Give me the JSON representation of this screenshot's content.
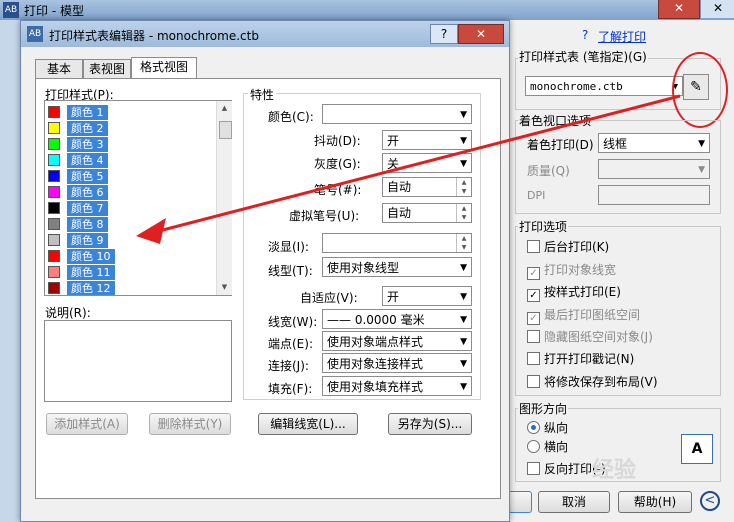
{
  "colors": {
    "accent": "#3b84d8",
    "annotation_red": "#e02020",
    "title_gradient": "#9ebadb"
  },
  "bg_window": {
    "title": "打印 - 模型",
    "app_icon": "AB",
    "close": "✕",
    "close2": "✕"
  },
  "plot_style_group": {
    "label": "打印样式表 (笔指定)(G)",
    "value": "monochrome.ctb",
    "help_link": "了解打印",
    "help_icon": "?"
  },
  "viewport_group": {
    "label": "着色视口选项",
    "shade_label": "着色打印(D)",
    "shade_value": "线框",
    "quality_label": "质量(Q)",
    "quality_value": "",
    "dpi_label": "DPI",
    "dpi_value": ""
  },
  "options_group": {
    "label": "打印选项",
    "items": [
      {
        "label": "后台打印(K)",
        "checked": false,
        "enabled": true
      },
      {
        "label": "打印对象线宽",
        "checked": true,
        "enabled": false
      },
      {
        "label": "按样式打印(E)",
        "checked": true,
        "enabled": true
      },
      {
        "label": "最后打印图纸空间",
        "checked": true,
        "enabled": false
      },
      {
        "label": "隐藏图纸空间对象(J)",
        "checked": false,
        "enabled": false
      },
      {
        "label": "打开打印戳记(N)",
        "checked": false,
        "enabled": true
      },
      {
        "label": "将修改保存到布局(V)",
        "checked": false,
        "enabled": true
      }
    ]
  },
  "orientation_group": {
    "label": "图形方向",
    "portrait": "纵向",
    "landscape": "横向",
    "reverse": "反向打印(-)",
    "icon": "A",
    "selected": "portrait"
  },
  "bottom_buttons": {
    "cancel": "取消",
    "help": "帮助(H)",
    "back_icon": "<"
  },
  "watermark": "经验",
  "editor": {
    "title": "打印样式表编辑器 - monochrome.ctb",
    "help_btn": "?",
    "close_btn": "✕",
    "tabs": [
      "基本",
      "表视图",
      "格式视图"
    ],
    "active_tab": 2,
    "styles_label": "打印样式(P):",
    "styles": [
      {
        "name": "颜色 1",
        "color": "#ff0000"
      },
      {
        "name": "颜色 2",
        "color": "#ffff00"
      },
      {
        "name": "颜色 3",
        "color": "#00ff00"
      },
      {
        "name": "颜色 4",
        "color": "#00ffff"
      },
      {
        "name": "颜色 5",
        "color": "#0000ff"
      },
      {
        "name": "颜色 6",
        "color": "#ff00ff"
      },
      {
        "name": "颜色 7",
        "color": "#000000"
      },
      {
        "name": "颜色 8",
        "color": "#808080"
      },
      {
        "name": "颜色 9",
        "color": "#c0c0c0"
      },
      {
        "name": "颜色 10",
        "color": "#ff0000"
      },
      {
        "name": "颜色 11",
        "color": "#ff7f7f"
      },
      {
        "name": "颜色 12",
        "color": "#a50000"
      }
    ],
    "desc_label": "说明(R):",
    "add_style": "添加样式(A)",
    "delete_style": "删除样式(Y)",
    "edit_lineweights": "编辑线宽(L)...",
    "save_as": "另存为(S)...",
    "props_label": "特性",
    "props": {
      "color_label": "颜色(C):",
      "color_value": "",
      "dither_label": "抖动(D):",
      "dither_value": "开",
      "grayscale_label": "灰度(G):",
      "grayscale_value": "关",
      "pen_label": "笔号(#):",
      "pen_value": "自动",
      "vpen_label": "虚拟笔号(U):",
      "vpen_value": "自动",
      "screening_label": "淡显(I):",
      "screening_value": "",
      "linetype_label": "线型(T):",
      "linetype_value": "使用对象线型",
      "adaptive_label": "自适应(V):",
      "adaptive_value": "开",
      "lineweight_label": "线宽(W):",
      "lineweight_value": "—— 0.0000 毫米",
      "endstyle_label": "端点(E):",
      "endstyle_value": "使用对象端点样式",
      "joinstyle_label": "连接(J):",
      "joinstyle_value": "使用对象连接样式",
      "fillstyle_label": "填充(F):",
      "fillstyle_value": "使用对象填充样式"
    }
  }
}
